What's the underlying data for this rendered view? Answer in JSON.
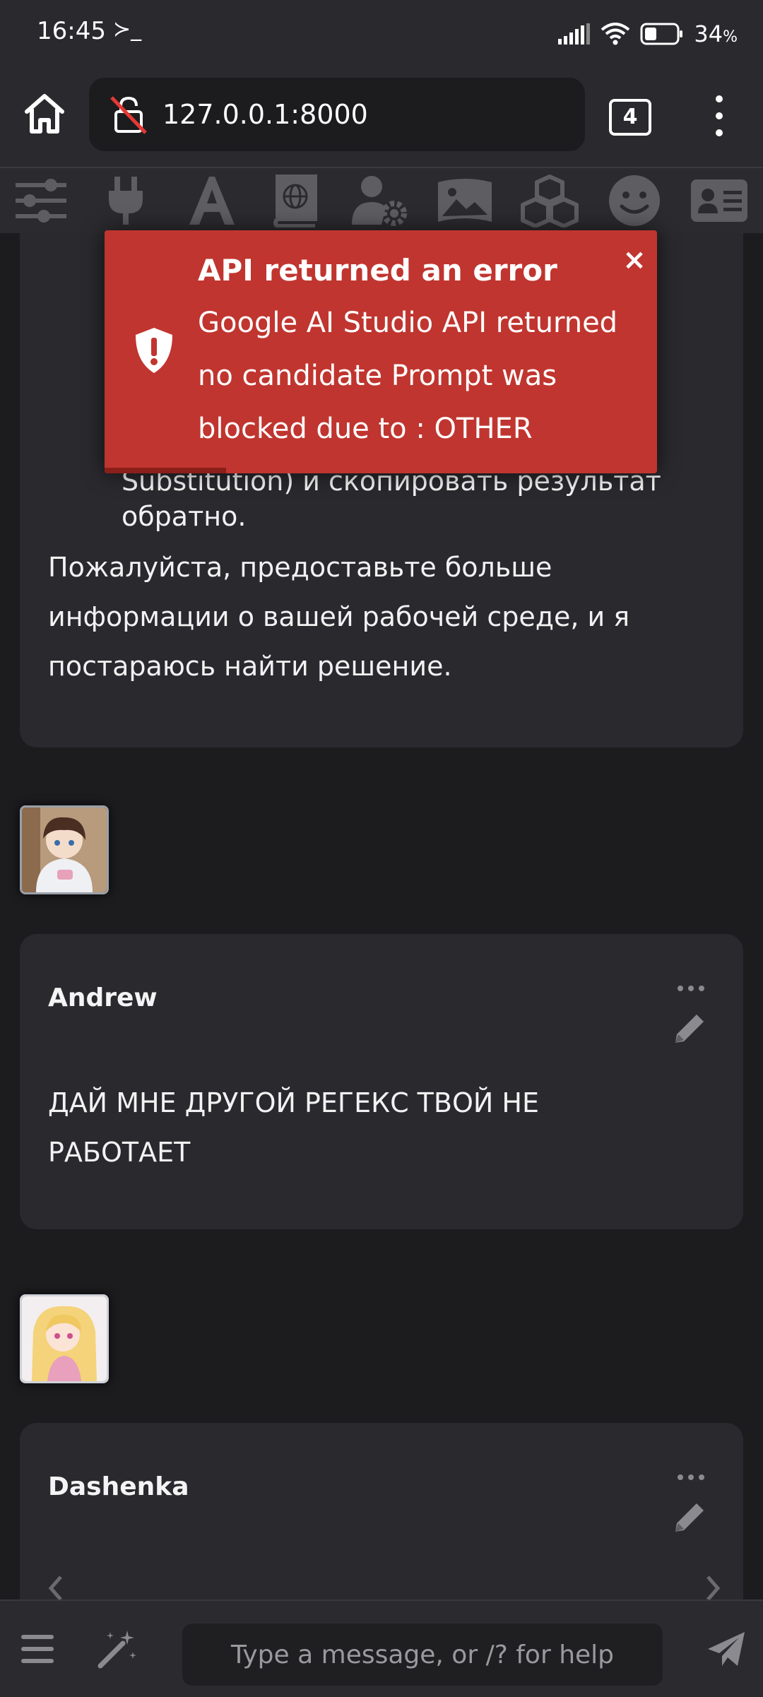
{
  "status_bar": {
    "time": "16:45",
    "terminal_glyph": "≻_",
    "battery_percent": "34",
    "battery_unit": "%"
  },
  "browser": {
    "url": "127.0.0.1:8000",
    "tab_count": "4"
  },
  "toolbar": {
    "icons": [
      "sliders-icon",
      "plug-icon",
      "font-icon",
      "book-globe-icon",
      "user-gear-icon",
      "image-icon",
      "cubes-icon",
      "smile-icon",
      "id-card-icon"
    ]
  },
  "chat": {
    "partial_line_1": "Substitution) и скопировать результат",
    "partial_line_2": "обратно.",
    "paragraph": [
      "Пожалуйста, предоставьте больше",
      "информации о вашей рабочей среде, и я",
      "постараюсь найти решение."
    ],
    "messages": [
      {
        "name": "Andrew",
        "text": [
          "ДАЙ МНЕ ДРУГОЙ РЕГЕКС ТВОЙ НЕ",
          "РАБОТАЕТ"
        ]
      },
      {
        "name": "Dashenka"
      }
    ]
  },
  "toast": {
    "title": "API returned an error",
    "message": "Google AI Studio API returned no candidate Prompt was blocked due to : OTHER",
    "close_label": "×",
    "progress_fraction": 0.22
  },
  "input": {
    "placeholder": "Type a message, or /? for help"
  },
  "colors": {
    "toast_bg": "#c0352f",
    "card_bg": "#29292e",
    "page_bg": "#1c1c1f"
  }
}
